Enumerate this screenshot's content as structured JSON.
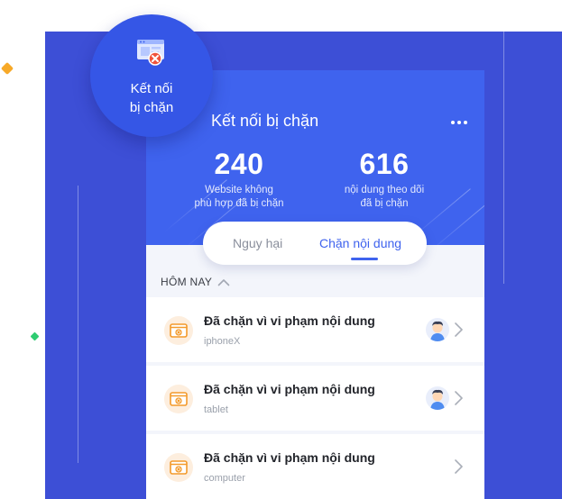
{
  "badge": {
    "label": "Kết nối\nbị chặn",
    "icon": "browser-blocked-icon"
  },
  "header": {
    "title": "Kết nối bị chặn",
    "more_icon": "more-dots-icon"
  },
  "stats": [
    {
      "value": "240",
      "label": "Website không\nphù hợp đã bị chặn"
    },
    {
      "value": "616",
      "label": "nội dung theo dõi\nđã bị chặn"
    }
  ],
  "tabs": [
    {
      "label": "Nguy hại",
      "active": false
    },
    {
      "label": "Chặn nội dung",
      "active": true
    }
  ],
  "section": {
    "title": "HÔM NAY",
    "icon": "chevron-up-icon"
  },
  "items": [
    {
      "title": "Đã chặn vì vi phạm nội dung",
      "device": "iphoneX",
      "has_avatar": true
    },
    {
      "title": "Đã chặn vì vi phạm nội dung",
      "device": "tablet",
      "has_avatar": true
    },
    {
      "title": "Đã chặn vì vi phạm nội dung",
      "device": "computer",
      "has_avatar": false
    }
  ],
  "colors": {
    "background_panel": "#3d4fd6",
    "header": "#3f63ee",
    "accent": "#3f63ee",
    "blocked_icon": "#f39a2b",
    "blocked_mark": "#f0533c"
  }
}
